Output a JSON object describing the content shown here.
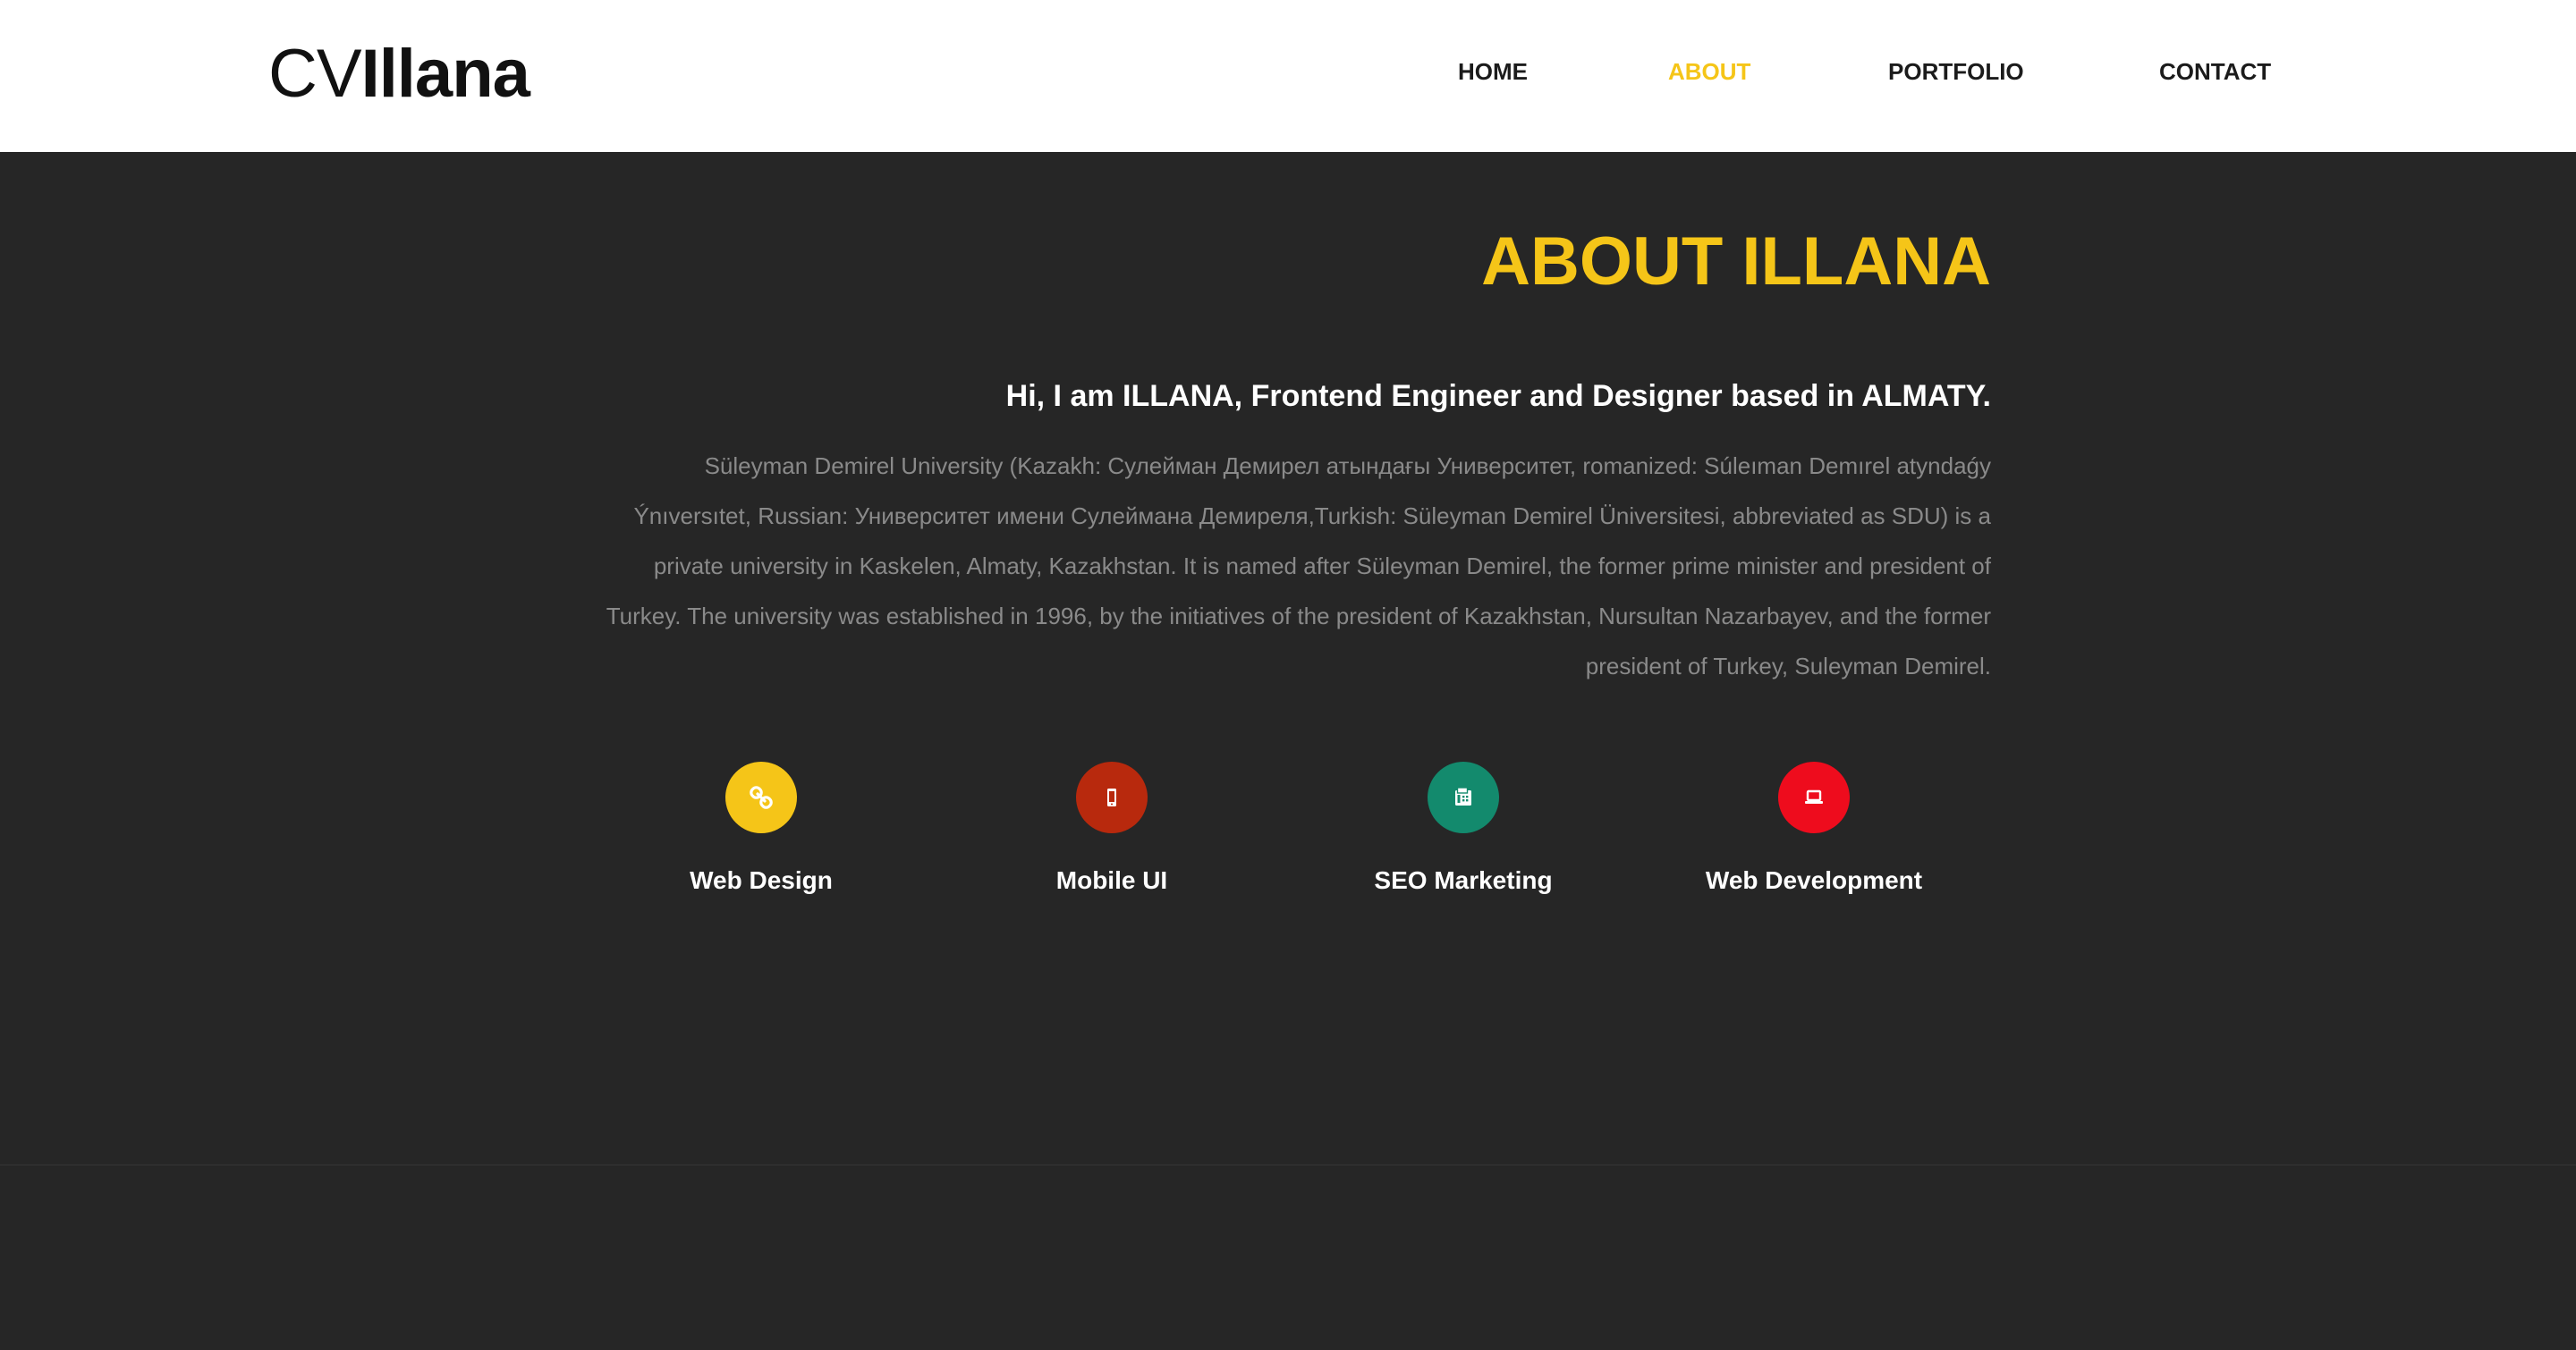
{
  "logo": {
    "light": "CV",
    "bold": "Illana"
  },
  "nav": {
    "items": [
      {
        "label": "HOME",
        "active": false
      },
      {
        "label": "ABOUT",
        "active": true
      },
      {
        "label": "PORTFOLIO",
        "active": false
      },
      {
        "label": "CONTACT",
        "active": false
      }
    ]
  },
  "about": {
    "title": "ABOUT ILLANA",
    "subtitle": "Hi, I am ILLANA, Frontend Engineer and Designer based in ALMATY.",
    "text": "Süleyman Demirel University (Kazakh: Сулейман Демирел атындағы Университет, romanized: Súleıman Demırel atyndaǵy Ýnıversıtet, Russian: Университет имени Сулеймана Демиреля,Turkish: Süleyman Demirel Üniversitesi, abbreviated as SDU) is a private university in Kaskelen, Almaty, Kazakhstan. It is named after Süleyman Demirel, the former prime minister and president of Turkey. The university was established in 1996, by the initiatives of the president of Kazakhstan, Nursultan Nazarbayev, and the former president of Turkey, Suleyman Demirel."
  },
  "services": [
    {
      "label": "Web Design",
      "icon": "link-icon",
      "color": "#f5c518"
    },
    {
      "label": "Mobile UI",
      "icon": "mobile-icon",
      "color": "#b8290d"
    },
    {
      "label": "SEO Marketing",
      "icon": "fax-icon",
      "color": "#138a6d"
    },
    {
      "label": "Web Development",
      "icon": "laptop-icon",
      "color": "#ee0c1d"
    }
  ],
  "colors": {
    "accent": "#f5c518",
    "background": "#262626",
    "header": "#ffffff",
    "body_text": "#8a8a8a"
  }
}
